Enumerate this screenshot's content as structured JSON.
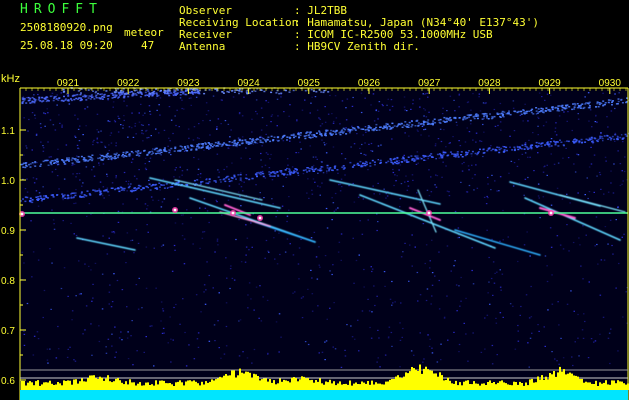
{
  "app": {
    "title": "HROFFT"
  },
  "file": {
    "name": "2508180920.png",
    "datetime": "25.08.18 09:20"
  },
  "counter": {
    "label": "meteor",
    "count": "47"
  },
  "info": [
    {
      "label": "Observer",
      "value": ": JL2TBB"
    },
    {
      "label": "Receiving Location",
      "value": ": Hamamatsu, Japan (N34°40' E137°43')"
    },
    {
      "label": "Receiver",
      "value": ": ICOM IC-R2500 53.1000MHz USB"
    },
    {
      "label": "Antenna",
      "value": ": HB9CV Zenith dir."
    }
  ],
  "axis": {
    "unit": "kHz",
    "y_ticks": [
      "1.1",
      "1.0",
      "0.9",
      "0.8",
      "0.7",
      "0.6"
    ],
    "x_ticks": [
      "0921",
      "0922",
      "0923",
      "0924",
      "0925",
      "0926",
      "0927",
      "0928",
      "0929",
      "0930"
    ]
  },
  "colors": {
    "text": "#ffff33",
    "title": "#3cff3c",
    "axis": "#ffff33",
    "carrier": "#4dff9a",
    "meter_yellow": "#ffff00",
    "meter_cyan": "#00e5ff"
  }
}
